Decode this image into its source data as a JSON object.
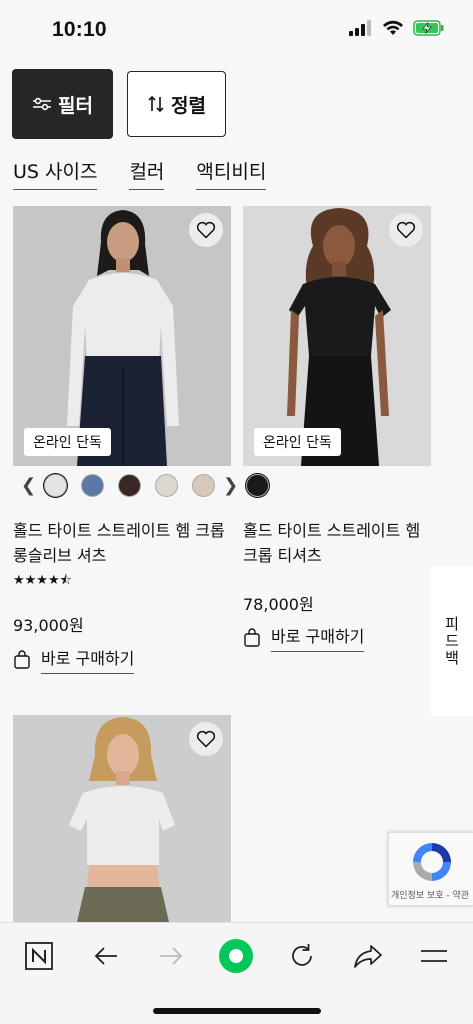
{
  "status": {
    "time": "10:10"
  },
  "toolbar": {
    "filter_label": "필터",
    "sort_label": "정렬"
  },
  "chips": [
    {
      "label": "US 사이즈"
    },
    {
      "label": "컬러"
    },
    {
      "label": "액티비티"
    }
  ],
  "products": [
    {
      "badge": "온라인 단독",
      "name": "홀드 타이트 스트레이트 헴 크롭 롱슬리브 셔츠",
      "rating_stars": "★★★★⯪",
      "price": "93,000원",
      "buy_label": "바로 구매하기",
      "swatch_colors": [
        "#e4e4e4",
        "#5b79a8",
        "#3a2624",
        "#dcd8d0",
        "#d9c7b8"
      ]
    },
    {
      "badge": "온라인 단독",
      "name": "홀드 타이트 스트레이트 헴 크롭 티셔츠",
      "price": "78,000원",
      "buy_label": "바로 구매하기",
      "swatch_colors": [
        "#1a1a1a"
      ]
    },
    {
      "badge": "",
      "name": ""
    }
  ],
  "side_tab": {
    "label": "피드백"
  },
  "recaptcha": {
    "label": "개인정보 보호 - 약관"
  },
  "browser_nav": {
    "icons": [
      "naver-n-icon",
      "back-arrow-icon",
      "forward-arrow-icon",
      "home-green-dot-icon",
      "reload-icon",
      "share-icon",
      "menu-icon"
    ],
    "accent": "#03c75a"
  }
}
